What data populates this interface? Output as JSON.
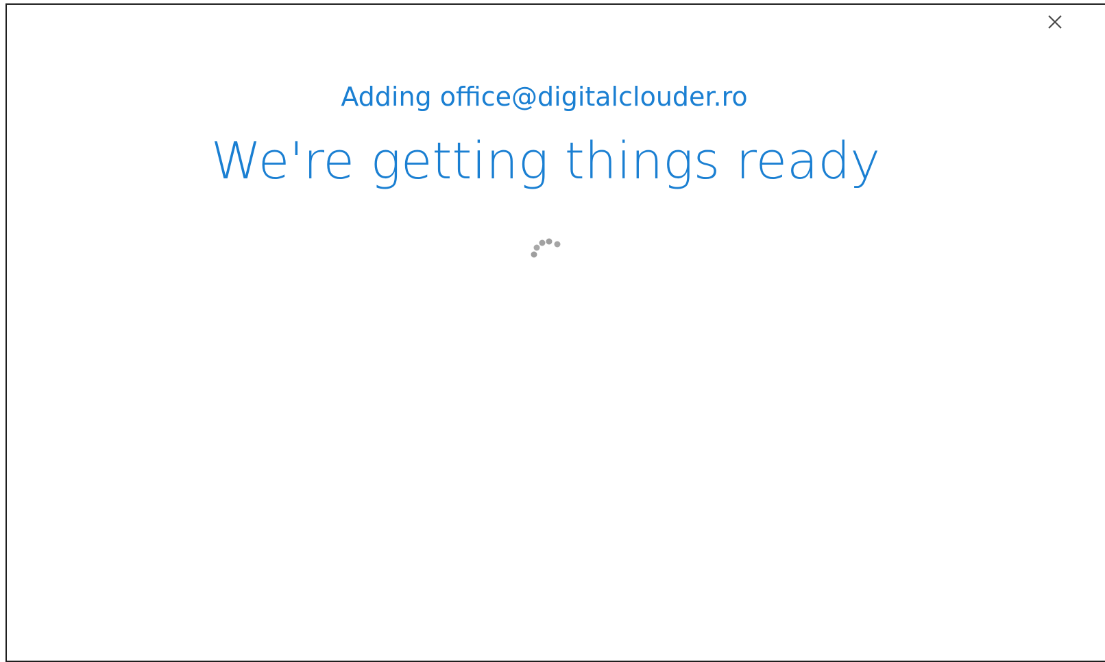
{
  "dialog": {
    "subtitle": "Adding office@digitalclouder.ro",
    "title": "We're getting things ready",
    "close_icon": "close-icon",
    "spinner_icon": "loading-spinner-icon"
  },
  "colors": {
    "accent": "#1a7fd2",
    "spinner": "#9e9e9e",
    "border": "#1f1f1f"
  }
}
